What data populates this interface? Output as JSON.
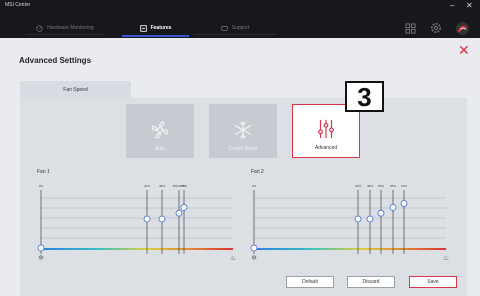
{
  "app": {
    "title": "MSI Center",
    "minimize_icon": "–",
    "close_icon": "✕"
  },
  "tabs": [
    {
      "label": "Hardware Monitoring",
      "icon": "gauge-icon",
      "active": false
    },
    {
      "label": "Features",
      "icon": "features-icon",
      "active": true
    },
    {
      "label": "Support",
      "icon": "support-icon",
      "active": false
    }
  ],
  "header_icons": [
    "grid-icon",
    "gear-icon",
    "msi-dragon-logo"
  ],
  "page": {
    "title": "Advanced Settings",
    "close_glyph": "✕"
  },
  "subtab": {
    "label": "Fan Speed"
  },
  "modes": [
    {
      "label": "Auto",
      "icon": "fan-icon",
      "selected": false
    },
    {
      "label": "Cooler Boost",
      "icon": "snowflake-icon",
      "selected": false
    },
    {
      "label": "Advanced",
      "icon": "sliders-icon",
      "selected": true
    }
  ],
  "badge": {
    "text": "3"
  },
  "fans": [
    {
      "label": "Fan 1",
      "point_labels": [
        "0%",
        "40%",
        "48%",
        "55%/48%",
        "75%"
      ],
      "points": [
        0,
        15,
        15,
        18,
        21
      ],
      "low_icon": "snowflake-icon",
      "high_icon": "flame-icon"
    },
    {
      "label": "Fan 2",
      "point_labels": [
        "0%",
        "40%",
        "48%",
        "55%",
        "65%",
        "75%"
      ],
      "points": [
        0,
        15,
        15,
        18,
        21,
        23
      ],
      "low_icon": "snowflake-icon",
      "high_icon": "flame-icon"
    }
  ],
  "buttons": {
    "default": "Default",
    "discard": "Discard",
    "save": "Save"
  },
  "colors": {
    "accent_red": "#d6384a",
    "tab_blue": "#3b54d6",
    "point_blue": "#3b6fd6"
  }
}
